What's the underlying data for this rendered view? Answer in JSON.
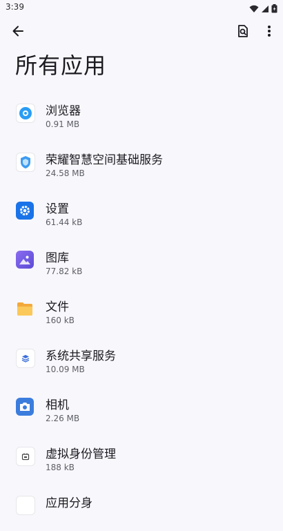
{
  "status_bar": {
    "time": "3:39"
  },
  "header": {
    "title": "所有应用"
  },
  "apps": [
    {
      "name": "浏览器",
      "size": "0.91 MB",
      "icon": "browser-icon"
    },
    {
      "name": "荣耀智慧空间基础服务",
      "size": "24.58 MB",
      "icon": "honor-smart-space-icon"
    },
    {
      "name": "设置",
      "size": "61.44 kB",
      "icon": "settings-gear-icon"
    },
    {
      "name": "图库",
      "size": "77.82 kB",
      "icon": "gallery-icon"
    },
    {
      "name": "文件",
      "size": "160 kB",
      "icon": "folder-icon"
    },
    {
      "name": "系统共享服务",
      "size": "10.09 MB",
      "icon": "system-share-icon"
    },
    {
      "name": "相机",
      "size": "2.26 MB",
      "icon": "camera-icon"
    },
    {
      "name": "虚拟身份管理",
      "size": "188 kB",
      "icon": "virtual-id-icon"
    },
    {
      "name": "应用分身",
      "size": "",
      "icon": "app-clone-icon"
    }
  ],
  "colors": {
    "background": "#f8f7fc",
    "settings_blue": "#1a73e8",
    "gallery_purple": "#7a5ae0",
    "folder_yellow": "#f6b93b",
    "camera_blue": "#3b7ddd"
  }
}
